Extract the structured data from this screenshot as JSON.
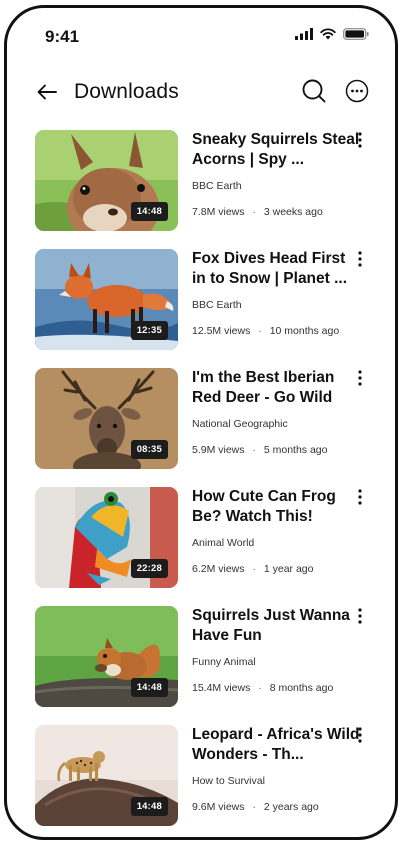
{
  "status": {
    "time": "9:41"
  },
  "header": {
    "title": "Downloads"
  },
  "icons": {
    "back": "arrow-left-icon",
    "search": "search-icon",
    "more": "more-horizontal-icon",
    "item_menu": "more-vertical-icon"
  },
  "items": [
    {
      "title": "Sneaky Squirrels Steal Acorns | Spy ...",
      "channel": "BBC Earth",
      "views": "7.8M views",
      "age": "3 weeks ago",
      "duration": "14:48"
    },
    {
      "title": "Fox Dives Head First in to Snow | Planet ...",
      "channel": "BBC Earth",
      "views": "12.5M views",
      "age": "10 months ago",
      "duration": "12:35"
    },
    {
      "title": "I'm the Best Iberian Red Deer - Go Wild",
      "channel": "National Geographic",
      "views": "5.9M views",
      "age": "5 months ago",
      "duration": "08:35"
    },
    {
      "title": "How Cute Can Frog Be? Watch This!",
      "channel": "Animal World",
      "views": "6.2M views",
      "age": "1 year ago",
      "duration": "22:28"
    },
    {
      "title": "Squirrels Just Wanna Have Fun",
      "channel": "Funny Animal",
      "views": "15.4M views",
      "age": "8 months ago",
      "duration": "14:48"
    },
    {
      "title": "Leopard - Africa's Wild Wonders - Th...",
      "channel": "How to Survival",
      "views": "9.6M views",
      "age": "2 years ago",
      "duration": "14:48"
    }
  ],
  "separator": "·"
}
